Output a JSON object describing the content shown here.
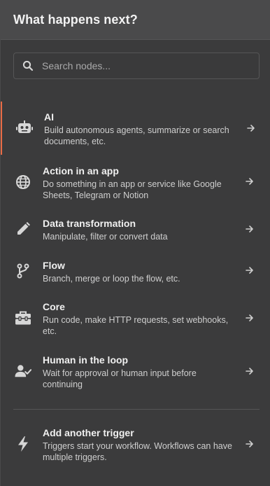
{
  "header": {
    "title": "What happens next?"
  },
  "search": {
    "placeholder": "Search nodes..."
  },
  "items": [
    {
      "title": "AI",
      "description": "Build autonomous agents, summarize or search documents, etc.",
      "icon": "robot-icon"
    },
    {
      "title": "Action in an app",
      "description": "Do something in an app or service like Google Sheets, Telegram or Notion",
      "icon": "globe-icon"
    },
    {
      "title": "Data transformation",
      "description": "Manipulate, filter or convert data",
      "icon": "pencil-icon"
    },
    {
      "title": "Flow",
      "description": "Branch, merge or loop the flow, etc.",
      "icon": "branch-icon"
    },
    {
      "title": "Core",
      "description": "Run code, make HTTP requests, set webhooks, etc.",
      "icon": "toolbox-icon"
    },
    {
      "title": "Human in the loop",
      "description": "Wait for approval or human input before continuing",
      "icon": "user-check-icon"
    }
  ],
  "trigger": {
    "title": "Add another trigger",
    "description": "Triggers start your workflow. Workflows can have multiple triggers.",
    "icon": "bolt-icon"
  },
  "colors": {
    "accent": "#ea6b45",
    "panel": "#3b3b3c",
    "header": "#4a4a4b"
  }
}
